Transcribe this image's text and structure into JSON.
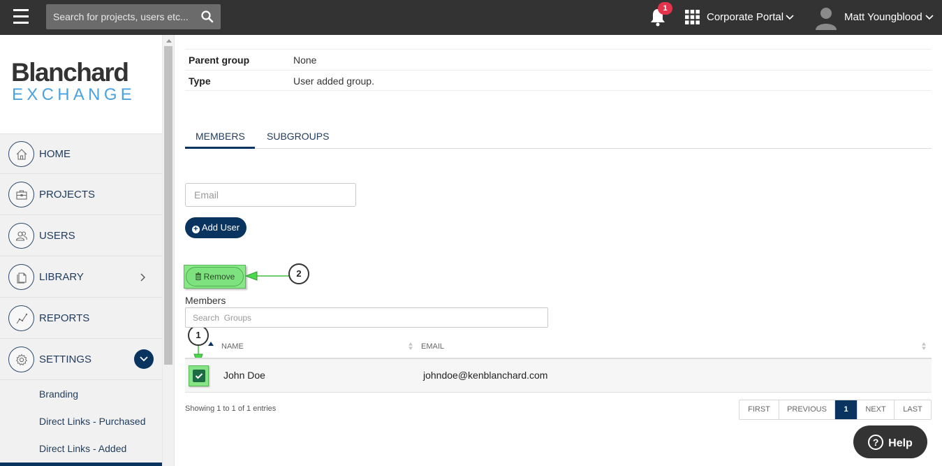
{
  "header": {
    "search_placeholder": "Search for projects, users etc...",
    "notification_count": "1",
    "portal_label": "Corporate Portal",
    "user_name": "Matt Youngblood"
  },
  "sidebar": {
    "logo_top": "Blanchard",
    "logo_bottom": "EXCHANGE",
    "items": [
      {
        "label": "HOME",
        "icon": "home-icon"
      },
      {
        "label": "PROJECTS",
        "icon": "briefcase-icon"
      },
      {
        "label": "USERS",
        "icon": "users-icon"
      },
      {
        "label": "LIBRARY",
        "icon": "document-icon"
      },
      {
        "label": "REPORTS",
        "icon": "chart-line-icon"
      },
      {
        "label": "SETTINGS",
        "icon": "gear-icon"
      }
    ],
    "sub_items": [
      "Branding",
      "Direct Links - Purchased",
      "Direct Links - Added"
    ]
  },
  "details": {
    "parent_group_label": "Parent group",
    "parent_group_value": "None",
    "type_label": "Type",
    "type_value": "User added group."
  },
  "tabs": [
    "MEMBERS",
    "SUBGROUPS"
  ],
  "members": {
    "email_placeholder": "Email",
    "add_user_label": "Add User",
    "remove_label": "Remove",
    "section_label": "Members",
    "search_placeholder": "Search  Groups",
    "columns": [
      "NAME",
      "EMAIL"
    ],
    "rows": [
      {
        "name": "John Doe",
        "email": "johndoe@kenblanchard.com",
        "checked": true
      }
    ],
    "showing_text": "Showing 1 to 1 of 1 entries"
  },
  "pagination": [
    "FIRST",
    "PREVIOUS",
    "1",
    "NEXT",
    "LAST"
  ],
  "callouts": [
    "1",
    "2"
  ],
  "help_label": "Help",
  "colors": {
    "topbar": "#333333",
    "primary": "#0a3460",
    "highlight_green": "#7ee27e",
    "badge_red": "#e4344b",
    "logo_blue": "#4aa3df"
  }
}
